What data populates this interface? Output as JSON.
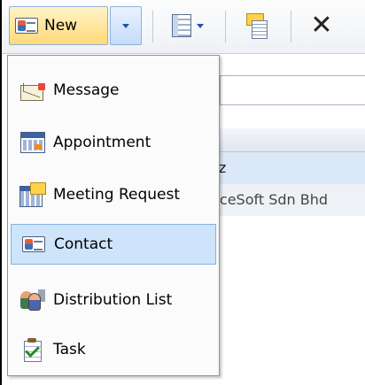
{
  "toolbar": {
    "new_label": "New",
    "icons": [
      "contact-card-icon",
      "chevron-down-icon",
      "view-icon",
      "move-to-folder-icon",
      "delete-icon"
    ]
  },
  "background": {
    "row1_text": "ziz",
    "row2_text": "viceSoft Sdn Bhd"
  },
  "menu": {
    "items": [
      {
        "label": "Message",
        "icon": "message-icon"
      },
      {
        "label": "Appointment",
        "icon": "appointment-icon"
      },
      {
        "label": "Meeting Request",
        "icon": "meeting-request-icon"
      },
      {
        "label": "Contact",
        "icon": "contact-icon",
        "selected": true
      },
      {
        "label": "Distribution List",
        "icon": "distribution-list-icon"
      },
      {
        "label": "Task",
        "icon": "task-icon"
      }
    ]
  },
  "colors": {
    "selection": "#cde4fb",
    "selection_border": "#86b2e2",
    "toolbar_hover": "#ffd978"
  }
}
